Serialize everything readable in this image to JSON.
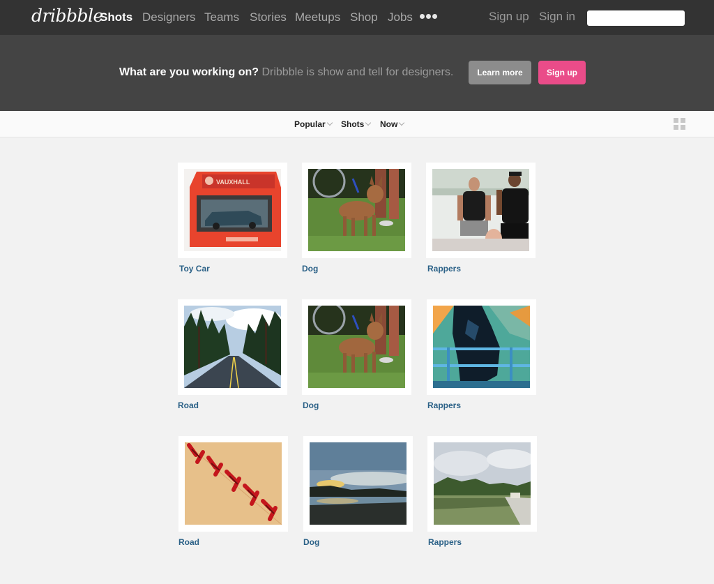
{
  "nav": {
    "logo": "dribbble",
    "items": [
      {
        "label": "Shots",
        "active": true
      },
      {
        "label": "Designers"
      },
      {
        "label": "Teams"
      },
      {
        "label": "Stories"
      },
      {
        "label": "Meetups"
      },
      {
        "label": "Shop"
      },
      {
        "label": "Jobs"
      }
    ],
    "more_icon": "more-dots-icon",
    "sign_up": "Sign up",
    "sign_in": "Sign in",
    "search_value": ""
  },
  "hero": {
    "question": "What are you working on?",
    "tagline": "Dribbble is show and tell for designers.",
    "learn_more": "Learn more",
    "sign_up": "Sign up"
  },
  "filters": {
    "sort": "Popular",
    "list": "Shots",
    "timeframe": "Now",
    "layout_icon": "grid-view-icon"
  },
  "shots": [
    {
      "title": "Toy Car",
      "image": "toy-car-image"
    },
    {
      "title": "Dog",
      "image": "dog-image"
    },
    {
      "title": "Rappers",
      "image": "rappers-image"
    },
    {
      "title": "Road",
      "image": "forest-road-image"
    },
    {
      "title": "Dog",
      "image": "dog-image"
    },
    {
      "title": "Rappers",
      "image": "statue-railing-image"
    },
    {
      "title": "Road",
      "image": "baseball-stitches-image"
    },
    {
      "title": "Dog",
      "image": "sunset-lake-image"
    },
    {
      "title": "Rappers",
      "image": "reflecting-pool-image"
    }
  ],
  "colors": {
    "topbar": "#333333",
    "hero": "#444444",
    "accent_pink": "#ea4c89",
    "link_blue": "#2b6187"
  }
}
